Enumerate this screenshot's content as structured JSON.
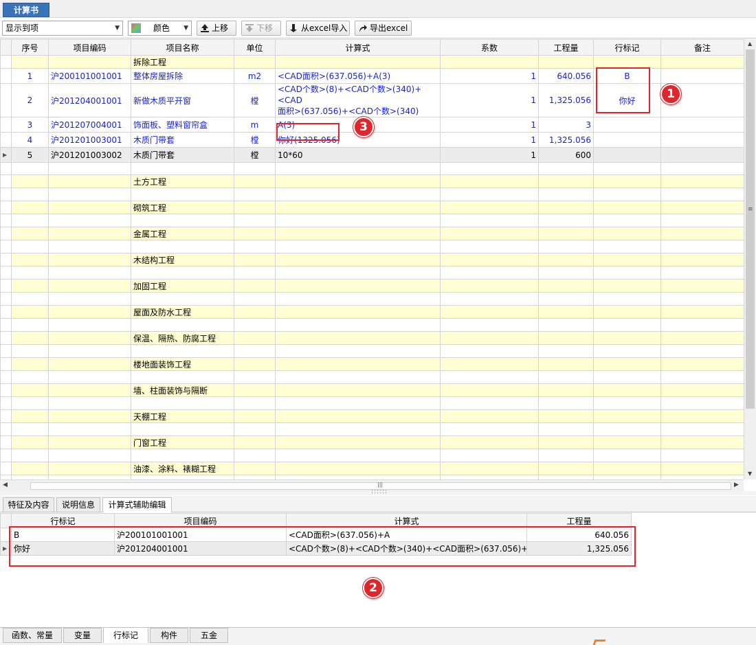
{
  "title_tab": "计算书",
  "toolbar": {
    "display_combo": "显示到项",
    "color_combo": "颜色",
    "move_up": "上移",
    "move_down": "下移",
    "import_excel": "从excel导入",
    "export_excel": "导出excel"
  },
  "grid": {
    "columns": [
      "序号",
      "项目编码",
      "项目名称",
      "单位",
      "计算式",
      "系数",
      "工程量",
      "行标记",
      "备注"
    ],
    "top_section": "拆除工程",
    "rows": [
      {
        "no": "1",
        "code": "沪200101001001",
        "name": "整体房屋拆除",
        "unit": "m2",
        "formula": "<CAD面积>(637.056)+A(3)",
        "formula2": "",
        "coef": "1",
        "qty": "640.056",
        "mark": "B"
      },
      {
        "no": "2",
        "code": "沪201204001001",
        "name": "新做木质平开窗",
        "unit": "樘",
        "formula": "<CAD个数>(8)+<CAD个数>(340)+<CAD",
        "formula2": "面积>(637.056)+<CAD个数>(340)",
        "coef": "1",
        "qty": "1,325.056",
        "mark": "你好"
      },
      {
        "no": "3",
        "code": "沪201207004001",
        "name": "饰面板、塑料窗帘盒",
        "unit": "m",
        "formula": "A(3)",
        "formula2": "",
        "coef": "1",
        "qty": "3",
        "mark": ""
      },
      {
        "no": "4",
        "code": "沪201201003001",
        "name": "木质门带套",
        "unit": "樘",
        "formula": "你好(1325.056)",
        "formula2": "",
        "coef": "1",
        "qty": "1,325.056",
        "mark": ""
      },
      {
        "no": "5",
        "code": "沪201201003002",
        "name": "木质门带套",
        "unit": "樘",
        "formula": "10*60",
        "formula2": "",
        "coef": "1",
        "qty": "600",
        "mark": ""
      }
    ],
    "sections": [
      "土方工程",
      "砌筑工程",
      "金属工程",
      "木结构工程",
      "加固工程",
      "屋面及防水工程",
      "保温、隔热、防腐工程",
      "楼地面装饰工程",
      "墙、柱面装饰与隔断",
      "天棚工程",
      "门窗工程",
      "油漆、涂料、裱糊工程"
    ]
  },
  "middle_tabs": [
    "特征及内容",
    "说明信息",
    "计算式辅助编辑"
  ],
  "lower_grid": {
    "columns": [
      "行标记",
      "项目编码",
      "计算式",
      "工程量"
    ],
    "rows": [
      {
        "mark": "B",
        "code": "沪200101001001",
        "formula": "<CAD面积>(637.056)+A",
        "qty": "640.056"
      },
      {
        "mark": "你好",
        "code": "沪201204001001",
        "formula": "<CAD个数>(8)+<CAD个数>(340)+<CAD面积>(637.056)+<...",
        "qty": "1,325.056"
      }
    ]
  },
  "bottom_tabs": [
    "函数、常量",
    "变量",
    "行标记",
    "构件",
    "五金"
  ],
  "badges": {
    "one": "1",
    "two": "2",
    "three": "3"
  },
  "colors": {
    "accent": "#3b73b9",
    "row_highlight": "#ffffd3",
    "link_blue": "#1a25c8",
    "annotation_red": "#e0262c"
  }
}
